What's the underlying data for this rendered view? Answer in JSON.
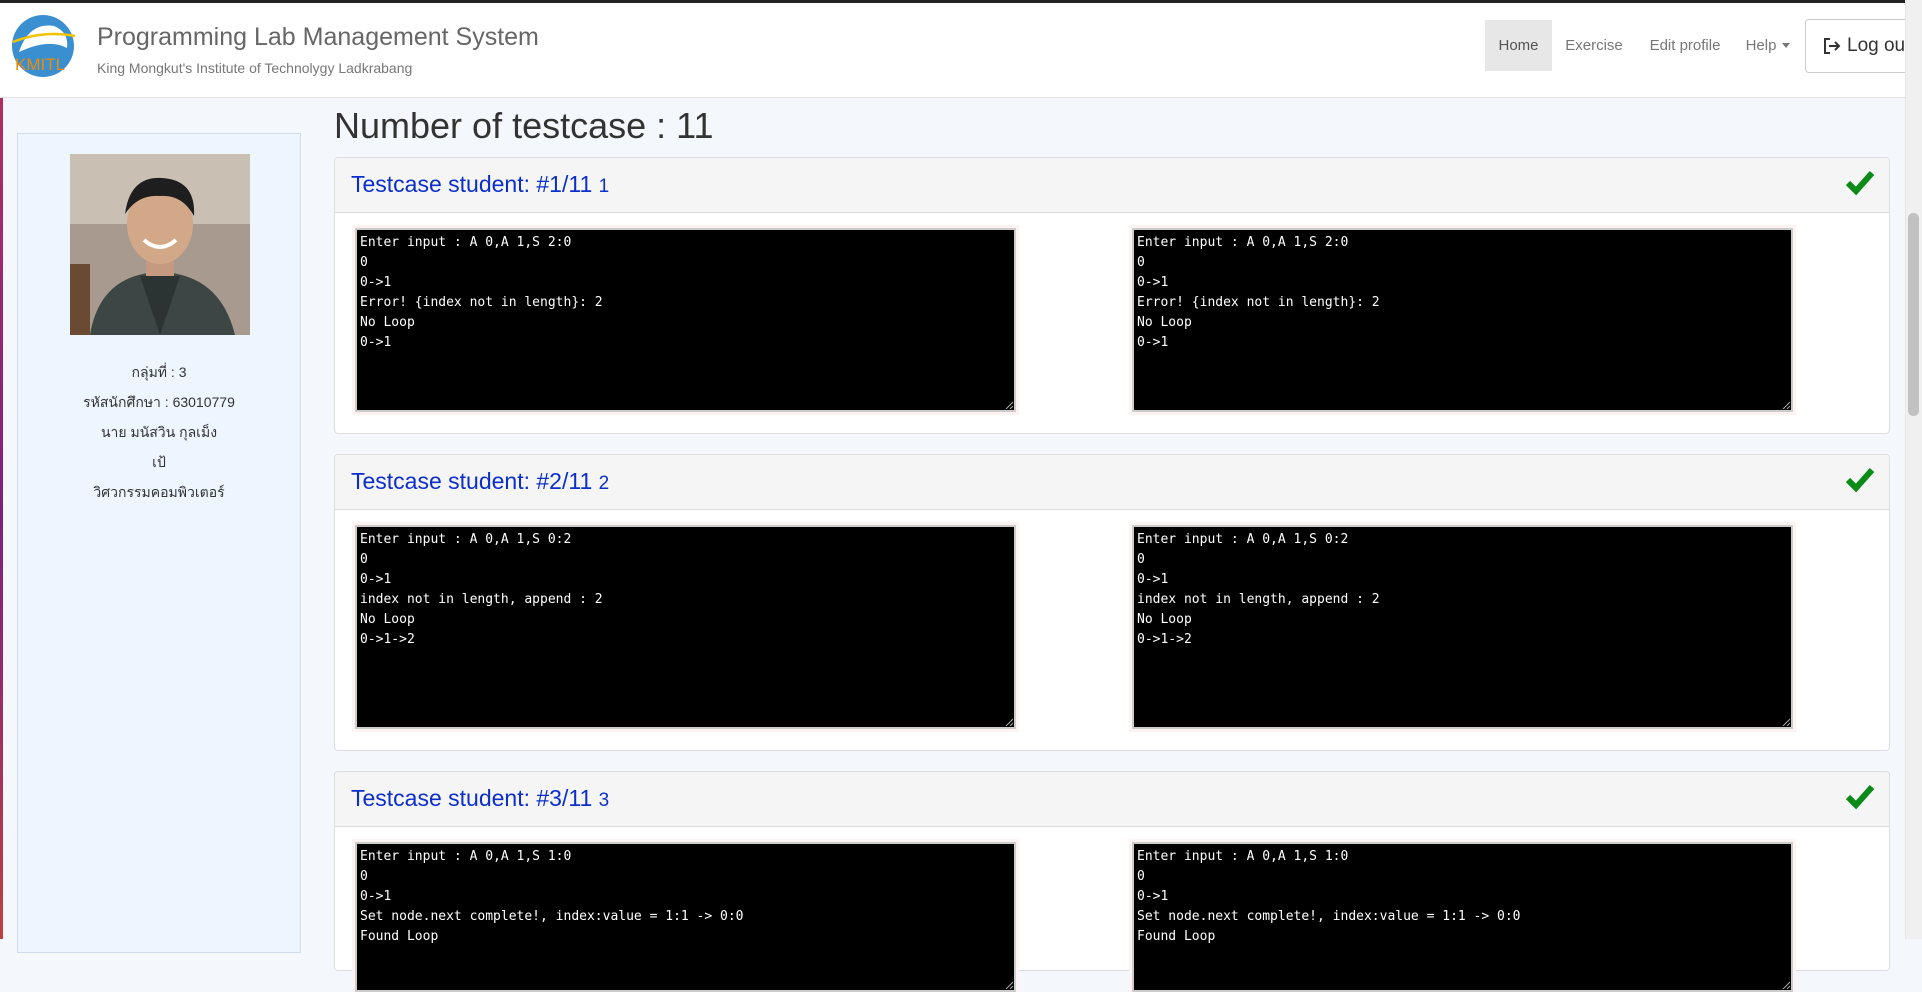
{
  "header": {
    "title": "Programming Lab Management System",
    "subtitle": "King Mongkut's Institute of Technolygy Ladkrabang",
    "logo_text": "KMITL",
    "nav": [
      {
        "label": "Home",
        "active": true
      },
      {
        "label": "Exercise"
      },
      {
        "label": "Edit profile"
      },
      {
        "label": "Help"
      }
    ],
    "logout_label": "Log out"
  },
  "profile": {
    "group": "กลุ่มที่ : 3",
    "student_id": "รหัสนักศึกษา : 63010779",
    "name": "นาย มนัสวิน กุลเม็ง",
    "nickname": "เป้",
    "department": "วิศวกรรมคอมพิวเตอร์"
  },
  "main": {
    "heading": "Number of testcase : 11"
  },
  "testcases": [
    {
      "title": "Testcase student: #1/11",
      "num": "1",
      "passed": true,
      "student_output": [
        "Enter input : A 0,A 1,S 2:0",
        "0",
        "0->1",
        "Error! {index not in length}: 2",
        "No Loop",
        "0->1"
      ],
      "expected_output": [
        "Enter input : A 0,A 1,S 2:0",
        "0",
        "0->1",
        "Error! {index not in length}: 2",
        "No Loop",
        "0->1"
      ]
    },
    {
      "title": "Testcase student: #2/11",
      "num": "2",
      "passed": true,
      "student_output": [
        "Enter input : A 0,A 1,S 0:2",
        "0",
        "0->1",
        "index not in length, append : 2",
        "No Loop",
        "0->1->2"
      ],
      "expected_output": [
        "Enter input : A 0,A 1,S 0:2",
        "0",
        "0->1",
        "index not in length, append : 2",
        "No Loop",
        "0->1->2"
      ]
    },
    {
      "title": "Testcase student: #3/11",
      "num": "3",
      "passed": true,
      "student_output": [
        "Enter input : A 0,A 1,S 1:0",
        "0",
        "0->1",
        "Set node.next complete!, index:value = 1:1 -> 0:0",
        "Found Loop"
      ],
      "expected_output": [
        "Enter input : A 0,A 1,S 1:0",
        "0",
        "0->1",
        "Set node.next complete!, index:value = 1:1 -> 0:0",
        "Found Loop"
      ]
    }
  ],
  "colors": {
    "title_blue": "#0b2ecc",
    "check_green": "#0a8a16",
    "terminal_bg": "#000000"
  }
}
